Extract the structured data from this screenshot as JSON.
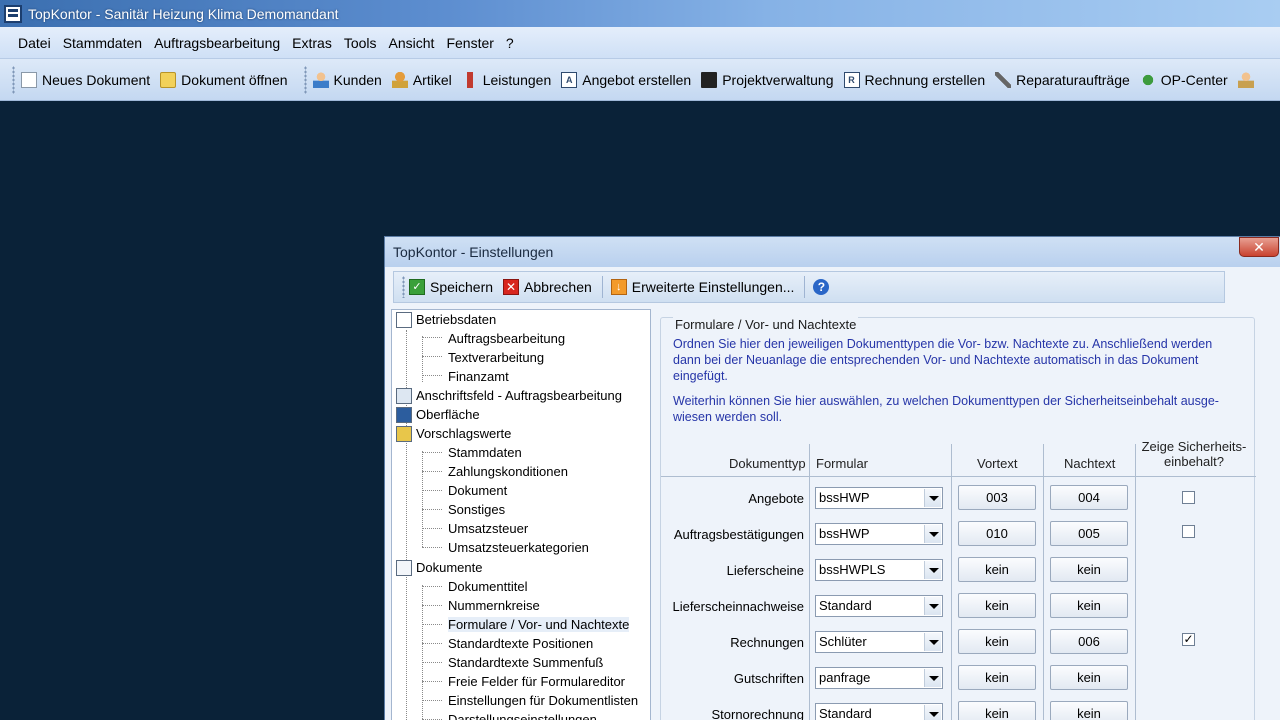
{
  "window": {
    "title": "TopKontor -  Sanitär Heizung Klima Demomandant"
  },
  "menu": [
    "Datei",
    "Stammdaten",
    "Auftragsbearbeitung",
    "Extras",
    "Tools",
    "Ansicht",
    "Fenster",
    "?"
  ],
  "toolbar": {
    "items": [
      {
        "label": "Neues Dokument",
        "icon": "new-document-icon"
      },
      {
        "label": "Dokument öffnen",
        "icon": "open-folder-icon"
      },
      {
        "label": "Kunden",
        "icon": "customers-icon"
      },
      {
        "label": "Artikel",
        "icon": "articles-icon"
      },
      {
        "label": "Leistungen",
        "icon": "services-icon"
      },
      {
        "label": "Angebot erstellen",
        "icon": "create-offer-icon"
      },
      {
        "label": "Projektverwaltung",
        "icon": "project-book-icon"
      },
      {
        "label": "Rechnung erstellen",
        "icon": "create-invoice-icon"
      },
      {
        "label": "Reparaturaufträge",
        "icon": "wrench-icon"
      },
      {
        "label": "OP-Center",
        "icon": "op-center-icon"
      }
    ]
  },
  "dialog": {
    "title": "TopKontor - Einstellungen",
    "close_label": "✕",
    "toolbar": {
      "save": "Speichern",
      "cancel": "Abbrechen",
      "advanced": "Erweiterte Einstellungen...",
      "help": "?"
    },
    "tree": {
      "betriebsdaten": "Betriebsdaten",
      "auftragsbearbeitung": "Auftragsbearbeitung",
      "textverarbeitung": "Textverarbeitung",
      "finanzamt": "Finanzamt",
      "anschriftsfeld": "Anschriftsfeld - Auftragsbearbeitung",
      "oberflaeche": "Oberfläche",
      "vorschlagswerte": "Vorschlagswerte",
      "stammdaten": "Stammdaten",
      "zahlungskonditionen": "Zahlungskonditionen",
      "dokument": "Dokument",
      "sonstiges": "Sonstiges",
      "umsatzsteuer": "Umsatzsteuer",
      "umsatzsteuerkategorien": "Umsatzsteuerkategorien",
      "dokumente": "Dokumente",
      "dokumenttitel": "Dokumenttitel",
      "nummernkreise": "Nummernkreise",
      "formulare": "Formulare / Vor- und Nachtexte",
      "standardtexte_pos": "Standardtexte Positionen",
      "standardtexte_sum": "Standardtexte Summenfuß",
      "freie_felder": "Freie Felder für Formulareditor",
      "dokumentlisten": "Einstellungen für Dokumentlisten",
      "darstellung": "Darstellungseinstellungen"
    },
    "panel": {
      "group_title": "Formulare / Vor- und Nachtexte",
      "info1": "Ordnen Sie hier den jeweiligen Dokumenttypen die Vor- bzw. Nachtexte zu. Anschließend werden dann bei der Neuanlage die entsprechenden Vor- und Nachtexte automatisch in das Dokument eingefügt.",
      "info2": "Weiterhin können Sie hier auswählen, zu welchen Dokumenttypen der Sicherheitseinbehalt ausge-wiesen werden soll.",
      "headers": {
        "doctype": "Dokumenttyp",
        "form": "Formular",
        "vortext": "Vortext",
        "nachtext": "Nachtext",
        "sicherheit1": "Zeige Sicherheits-",
        "sicherheit2": "einbehalt?"
      },
      "rows": [
        {
          "type": "Angebote",
          "form": "bssHWP",
          "vortext": "003",
          "nachtext": "004",
          "check": "unchecked"
        },
        {
          "type": "Auftragsbestätigungen",
          "form": "bssHWP",
          "vortext": "010",
          "nachtext": "005",
          "check": "unchecked"
        },
        {
          "type": "Lieferscheine",
          "form": "bssHWPLS",
          "vortext": "kein",
          "nachtext": "kein",
          "check": "none"
        },
        {
          "type": "Lieferscheinnachweise",
          "form": "Standard",
          "vortext": "kein",
          "nachtext": "kein",
          "check": "none"
        },
        {
          "type": "Rechnungen",
          "form": "Schlüter",
          "vortext": "kein",
          "nachtext": "006",
          "check": "checked"
        },
        {
          "type": "Gutschriften",
          "form": "panfrage",
          "vortext": "kein",
          "nachtext": "kein",
          "check": "none"
        },
        {
          "type": "Stornorechnung",
          "form": "Standard",
          "vortext": "kein",
          "nachtext": "kein",
          "check": "none"
        }
      ]
    }
  }
}
